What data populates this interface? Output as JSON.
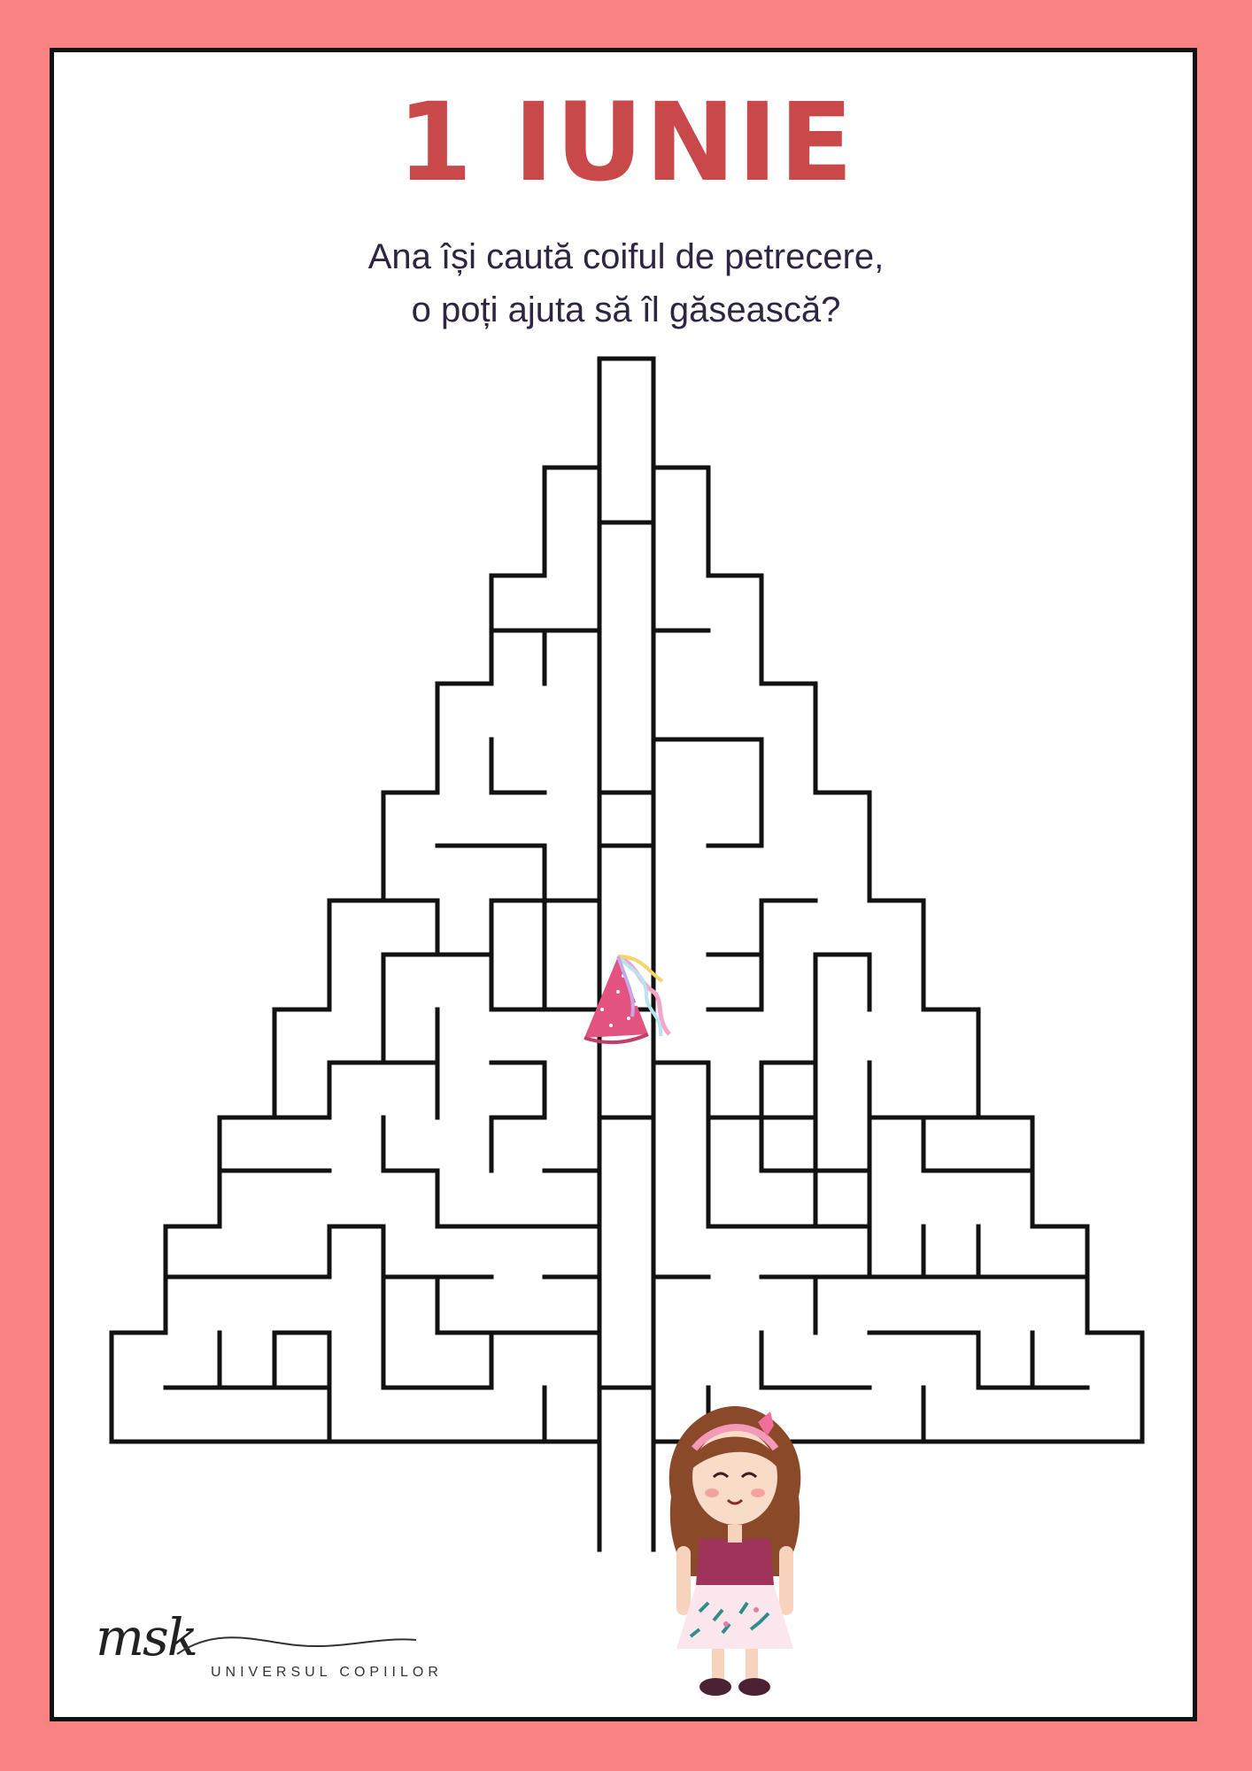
{
  "title": "1 IUNIE",
  "subtitle": [
    "Ana își caută coiful de petrecere,",
    "o poți ajuta să îl găsească?"
  ],
  "logo": {
    "script": "msk",
    "text": "UNIVERSUL COPIILOR"
  },
  "icons": {
    "goal": "party-hat-icon",
    "start": "girl-illustration"
  },
  "colors": {
    "frame": "#f98383",
    "title": "#c9494a",
    "text": "#2e2540",
    "maze": "#111111"
  }
}
